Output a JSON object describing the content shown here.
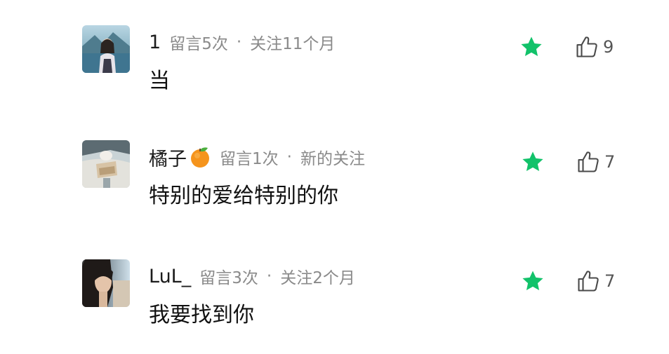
{
  "colors": {
    "star": "#12c26a",
    "meta": "#8a8a8a",
    "text": "#111111"
  },
  "comments": [
    {
      "username": "1",
      "count_label": "留言5次",
      "separator": "·",
      "follow_label": "关注11个月",
      "text": "当",
      "likes": "9",
      "star_icon": "star-icon",
      "like_icon": "thumbs-up-icon"
    },
    {
      "username": "橘子",
      "badge_icon": "tangerine-emoji",
      "count_label": "留言1次",
      "separator": "·",
      "follow_label": "新的关注",
      "text": "特别的爱给特别的你",
      "likes": "7",
      "star_icon": "star-icon",
      "like_icon": "thumbs-up-icon"
    },
    {
      "username": "LuL_",
      "count_label": "留言3次",
      "separator": "·",
      "follow_label": "关注2个月",
      "text": "我要找到你",
      "likes": "7",
      "star_icon": "star-icon",
      "like_icon": "thumbs-up-icon"
    }
  ]
}
